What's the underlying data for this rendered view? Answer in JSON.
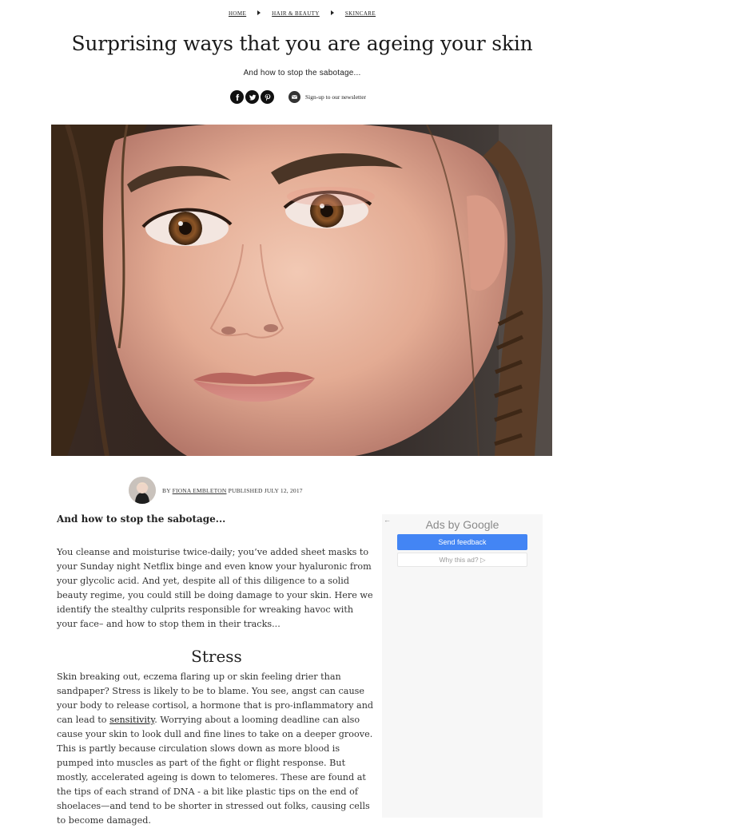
{
  "breadcrumb": {
    "items": [
      "HOME",
      "HAIR & BEAUTY",
      "SKINCARE"
    ]
  },
  "article": {
    "title": "Surprising ways that you are ageing your skin",
    "standfirst": "And how to stop the sabotage...",
    "byline": {
      "by_label": "BY",
      "author": "FIONA EMBLETON",
      "published_label": "PUBLISHED",
      "published_date": "JULY 12, 2017"
    },
    "lead": "And how to stop the sabotage...",
    "intro": "You cleanse and moisturise twice-daily; you’ve added sheet masks to your Sunday night Netflix binge and even know your hyaluronic from your glycolic acid. And yet, despite all of this diligence to a solid beauty regime, you could still be doing damage to your skin. Here we identify the stealthy culprits responsible for wreaking havoc with your face– and how to stop them in their tracks...",
    "section_heading": "Stress",
    "section_before_link": "Skin breaking out, eczema flaring up or skin feeling drier than sandpaper? Stress is likely to be to blame. You see, angst can cause your body to release cortisol, a hormone that is pro-inflammatory and can lead to ",
    "section_link": "sensitivity",
    "section_after_link": ". Worrying about a looming deadline can also cause your skin to look dull and fine lines to take on a deeper groove. This is partly because circulation slows down as more blood is pumped into muscles as part of the fight or flight response. But mostly, accelerated ageing is down to telomeres. These are found at the tips of each strand of DNA - a bit like plastic tips on the end of shoelaces—and tend to be shorter in stressed out folks, causing cells to become damaged."
  },
  "share": {
    "icons": [
      "facebook-icon",
      "twitter-icon",
      "pinterest-icon"
    ],
    "newsletter_label": "Sign-up to our newsletter"
  },
  "ad": {
    "back_glyph": "←",
    "title": "Ads by Google",
    "send_feedback": "Send feedback",
    "why_this_ad": "Why this ad? ▷"
  },
  "colors": {
    "ad_button": "#4385f4",
    "ad_panel": "#f7f7f7",
    "text": "#222222"
  }
}
